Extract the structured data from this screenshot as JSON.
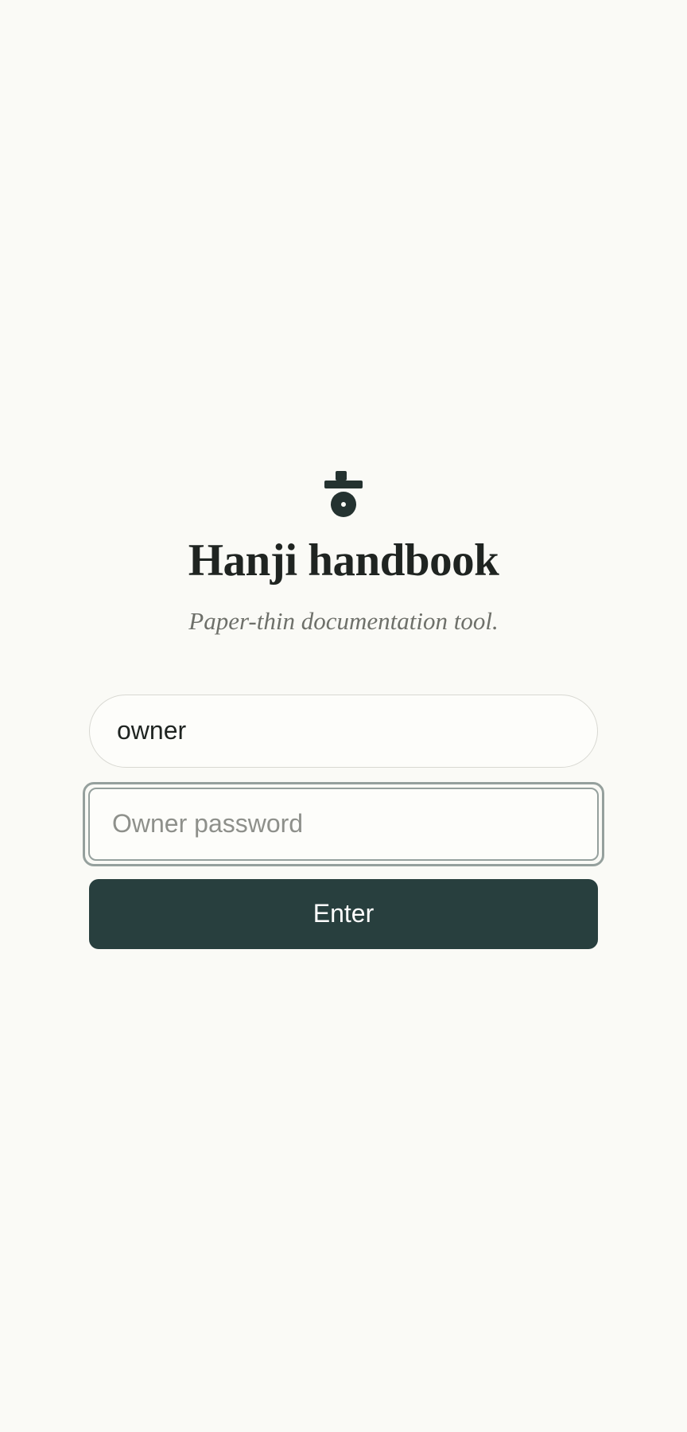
{
  "app": {
    "title": "Hanji handbook",
    "tagline": "Paper-thin documentation tool.",
    "logo_icon": "hanji-seal-icon"
  },
  "login": {
    "username_value": "owner",
    "password_placeholder": "Owner password",
    "submit_label": "Enter"
  },
  "colors": {
    "background": "#fafaf6",
    "accent": "#283f3e",
    "title_text": "#1f2421",
    "muted_text": "#6e706a",
    "focus_ring": "#95a09d"
  }
}
